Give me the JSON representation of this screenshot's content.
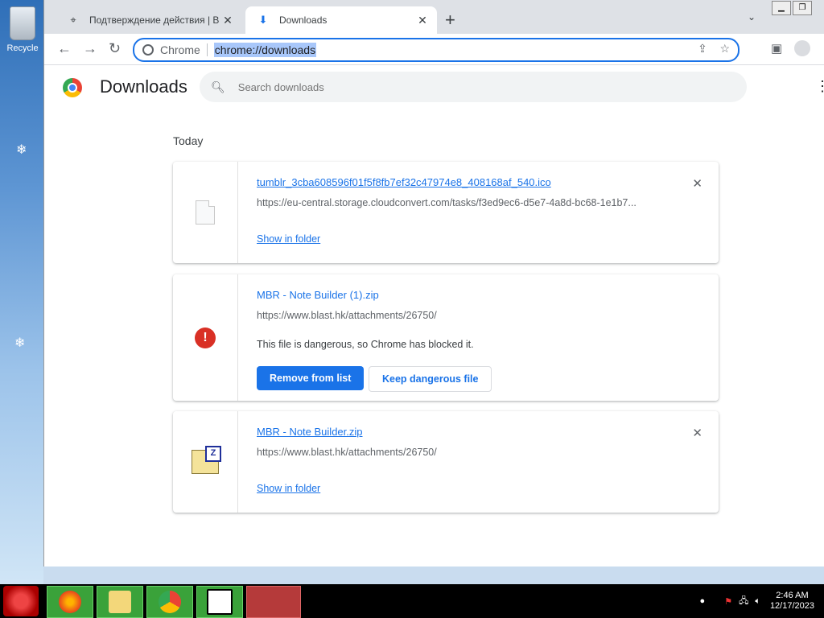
{
  "desktop": {
    "recycle_label": "Recycle"
  },
  "browser": {
    "tabs": [
      {
        "title": "Подтверждение действия | BLAST.hk",
        "active": false
      },
      {
        "title": "Downloads",
        "active": true
      }
    ],
    "new_tab_label": "+",
    "address": {
      "site_label": "Chrome",
      "url": "chrome://downloads"
    }
  },
  "page": {
    "title": "Downloads",
    "search_placeholder": "Search downloads",
    "section": "Today",
    "downloads": [
      {
        "name": "tumblr_3cba608596f01f5f8fb7ef32c47974e8_408168af_540.ico",
        "url": "https://eu-central.storage.cloudconvert.com/tasks/f3ed9ec6-d5e7-4a8d-bc68-1e1b7...",
        "action": "Show in folder",
        "icon": "file-icon"
      },
      {
        "name": "MBR - Note Builder (1).zip",
        "url": "https://www.blast.hk/attachments/26750/",
        "warning": "This file is dangerous, so Chrome has blocked it.",
        "remove_label": "Remove from list",
        "keep_label": "Keep dangerous file",
        "icon": "danger-icon"
      },
      {
        "name": "MBR - Note Builder.zip",
        "url": "https://www.blast.hk/attachments/26750/",
        "action": "Show in folder",
        "icon": "zip-icon"
      }
    ]
  },
  "taskbar": {
    "time": "2:46 AM",
    "date": "12/17/2023"
  },
  "colors": {
    "accent": "#1a73e8",
    "danger": "#d93025",
    "taskbar_app": "#3aa23a"
  }
}
